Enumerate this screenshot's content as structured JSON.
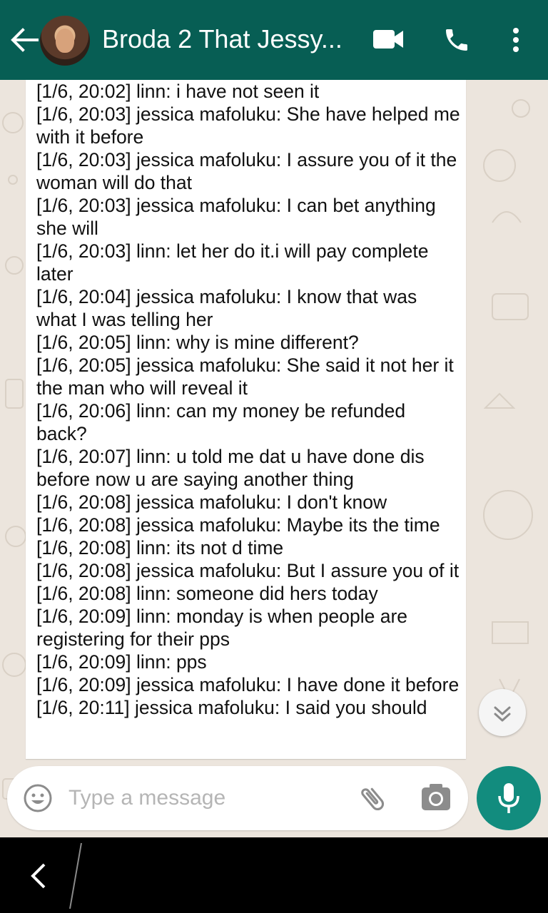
{
  "header": {
    "contact_name": "Broda 2 That Jessy...",
    "icons": [
      "back-arrow-icon",
      "avatar",
      "video-call-icon",
      "phone-icon",
      "more-options-icon"
    ]
  },
  "messages": [
    "[1/6, 20:02] linn: i have not seen it",
    "[1/6, 20:03] jessica mafoluku: She have helped me with it before",
    "[1/6, 20:03] jessica mafoluku: I assure you of it the woman will do that",
    "[1/6, 20:03] jessica mafoluku: I can bet anything she will",
    "[1/6, 20:03] linn: let her do it.i will pay complete later",
    "[1/6, 20:04] jessica mafoluku: I know that was what I was telling her",
    "[1/6, 20:05] linn: why is mine different?",
    "[1/6, 20:05] jessica mafoluku: She said it not her it the man who will reveal it",
    "[1/6, 20:06] linn: can my money be refunded back?",
    "[1/6, 20:07] linn: u told me dat u have done dis before now u are saying another thing",
    "[1/6, 20:08] jessica mafoluku: I don't know",
    "[1/6, 20:08] jessica mafoluku: Maybe its the time",
    "[1/6, 20:08] linn: its not d time",
    "[1/6, 20:08] jessica mafoluku: But I assure you of it",
    "[1/6, 20:08] linn: someone did hers today",
    "[1/6, 20:09] linn: monday is when people are registering for their pps",
    "[1/6, 20:09] linn: pps",
    "[1/6, 20:09] jessica mafoluku: I have done it before",
    "[1/6, 20:11] jessica mafoluku: I said you should"
  ],
  "composer": {
    "placeholder": "Type a message",
    "icons": [
      "emoji-icon",
      "attach-icon",
      "camera-icon",
      "mic-icon"
    ]
  },
  "colors": {
    "header_bg": "#075e54",
    "mic_bg": "#128c7e",
    "wallpaper": "#ece5dd"
  }
}
